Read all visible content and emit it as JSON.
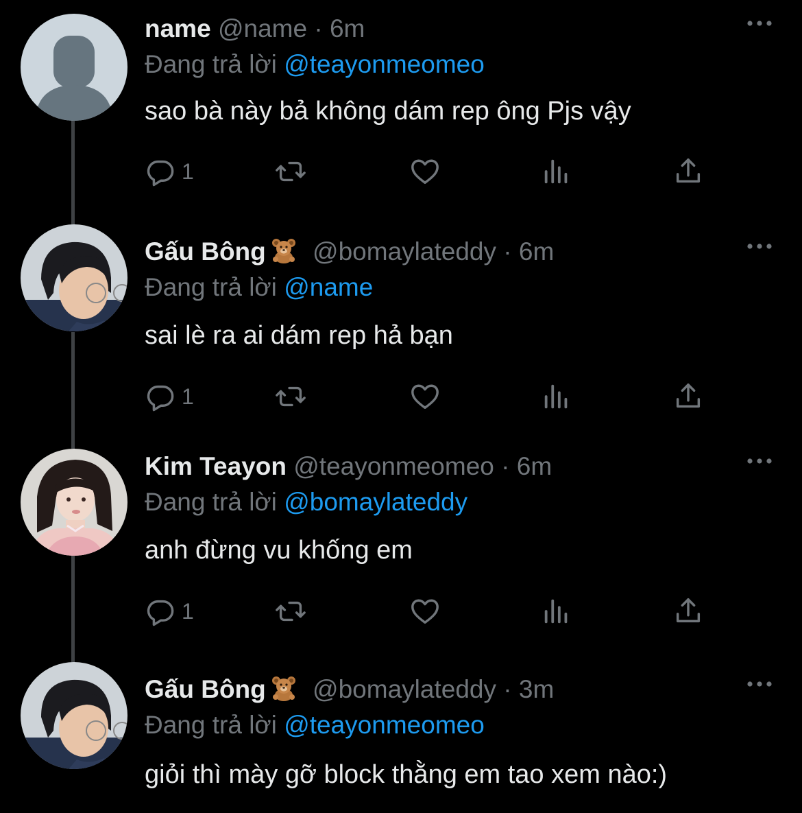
{
  "reply_label": "Đang trả lời",
  "tweets": [
    {
      "name": "name",
      "handle": "@name",
      "time": "6m",
      "replying_to": "@teayonmeomeo",
      "text": "sao bà này bả không dám rep ông Pjs vậy",
      "reply_count": "1",
      "avatar": "default-avatar",
      "emoji": ""
    },
    {
      "name": "Gấu Bông",
      "handle": "@bomaylateddy",
      "time": "6m",
      "replying_to": "@name",
      "text": "sai lè ra ai dám rep hả bạn",
      "reply_count": "1",
      "avatar": "photo-boy-glasses",
      "emoji": "teddy-bear-emoji"
    },
    {
      "name": "Kim Teayon",
      "handle": "@teayonmeomeo",
      "time": "6m",
      "replying_to": "@bomaylateddy",
      "text": "anh đừng vu khống em",
      "reply_count": "1",
      "avatar": "photo-girl",
      "emoji": ""
    },
    {
      "name": "Gấu Bông",
      "handle": "@bomaylateddy",
      "time": "3m",
      "replying_to": "@teayonmeomeo",
      "text": "giỏi thì mày gỡ block thằng em tao xem nào:)",
      "reply_count": "",
      "avatar": "photo-boy-glasses",
      "emoji": "teddy-bear-emoji"
    }
  ],
  "colors": {
    "background": "#000000",
    "text": "#e7e9ea",
    "secondary": "#71767b",
    "link": "#1d9bf0",
    "thread_line": "#3e4144"
  }
}
